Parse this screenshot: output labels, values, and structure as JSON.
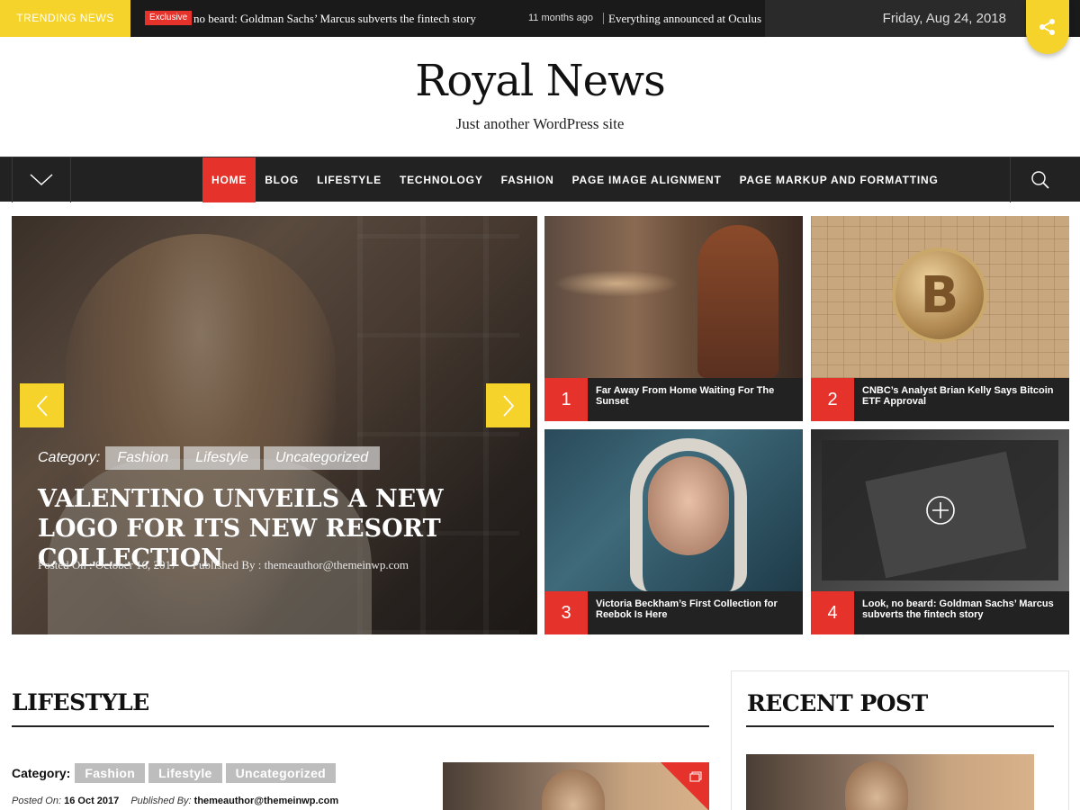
{
  "topbar": {
    "trending_label": "TRENDING NEWS",
    "badge": "Exclusive",
    "ticker_item_1": "no beard: Goldman Sachs’ Marcus subverts the fintech story",
    "ticker_time": "11 months ago",
    "ticker_item_2": "Everything announced at Oculus",
    "date": "Friday, Aug 24, 2018"
  },
  "header": {
    "title": "Royal News",
    "tagline": "Just another WordPress site"
  },
  "nav": {
    "items": [
      {
        "label": "HOME"
      },
      {
        "label": "BLOG"
      },
      {
        "label": "LIFESTYLE"
      },
      {
        "label": "TECHNOLOGY"
      },
      {
        "label": "FASHION"
      },
      {
        "label": "PAGE IMAGE ALIGNMENT"
      },
      {
        "label": "PAGE MARKUP AND FORMATTING"
      }
    ]
  },
  "slider": {
    "category_label": "Category:",
    "tags": [
      "Fashion",
      "Lifestyle",
      "Uncategorized"
    ],
    "title": "VALENTINO UNVEILS A NEW LOGO FOR ITS NEW RESORT COLLECTION",
    "posted": "Posted On : October 16, 2017",
    "author": "Published By : themeauthor@themeinwp.com"
  },
  "tiles": [
    {
      "number": "1",
      "title": "Far Away From Home Waiting For The Sunset"
    },
    {
      "number": "2",
      "title": "CNBC’s Analyst Brian Kelly Says Bitcoin ETF Approval"
    },
    {
      "number": "3",
      "title": "Victoria Beckham’s First Collection for Reebok Is Here"
    },
    {
      "number": "4",
      "title": "Look, no beard: Goldman Sachs’ Marcus subverts the fintech story"
    }
  ],
  "lifestyle": {
    "title": "LIFESTYLE",
    "category_label": "Category:",
    "tags": [
      "Fashion",
      "Lifestyle",
      "Uncategorized"
    ],
    "posted_key": "Posted On:",
    "posted_val": "16 Oct 2017",
    "published_key": "Published By:",
    "published_val": "themeauthor@themeinwp.com"
  },
  "recent": {
    "title": "RECENT POST"
  },
  "colors": {
    "accent_yellow": "#f5d32a",
    "accent_red": "#e5322b",
    "dark": "#222222"
  },
  "icons": {
    "share": "share-icon",
    "menu_toggle": "chevron-down-icon",
    "search": "search-icon",
    "prev": "chevron-left-icon",
    "next": "chevron-right-icon",
    "zoom": "plus-circle-icon",
    "gallery": "gallery-icon"
  }
}
